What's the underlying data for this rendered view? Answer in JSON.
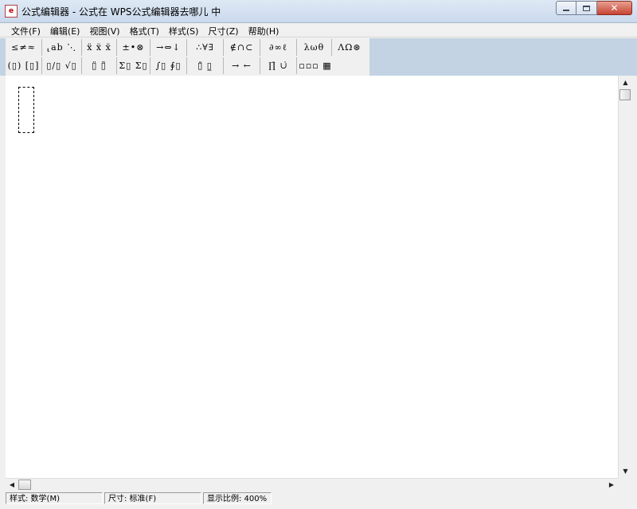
{
  "window": {
    "title": "公式编辑器 - 公式在 WPS公式编辑器去哪儿 中",
    "icon_label": "e",
    "controls": {
      "minimize_icon": "minimize-icon",
      "maximize_icon": "maximize-icon",
      "close_icon": "close-icon",
      "close_glyph": "✕"
    }
  },
  "menu": [
    {
      "label": "文件(F)"
    },
    {
      "label": "编辑(E)"
    },
    {
      "label": "视图(V)"
    },
    {
      "label": "格式(T)"
    },
    {
      "label": "样式(S)"
    },
    {
      "label": "尺寸(Z)"
    },
    {
      "label": "帮助(H)"
    }
  ],
  "toolbar": {
    "row1": [
      {
        "label": "≤≠≈",
        "name": "relations-palette"
      },
      {
        "label": "⸤ab ⋱",
        "name": "spaces-ellipses-palette"
      },
      {
        "label": "ẍ ẍ ẍ",
        "name": "embellishments-palette"
      },
      {
        "label": "±•⊗",
        "name": "operators-palette"
      },
      {
        "label": "→⇔↓",
        "name": "arrows-palette"
      },
      {
        "label": "∴∀∃",
        "name": "logic-palette"
      },
      {
        "label": "∉∩⊂",
        "name": "set-theory-palette"
      },
      {
        "label": "∂∞ℓ",
        "name": "misc-symbols-palette"
      },
      {
        "label": "λωθ",
        "name": "greek-lowercase-palette"
      },
      {
        "label": "ΛΩ⊛",
        "name": "greek-uppercase-palette"
      }
    ],
    "row2": [
      {
        "label": "(▯) [▯]",
        "name": "fences-templates"
      },
      {
        "label": "▯/▯ √▯",
        "name": "fractions-radicals-templates"
      },
      {
        "label": "▯̈ ▯̃",
        "name": "scripts-templates"
      },
      {
        "label": "Σ▯ Σ▯",
        "name": "summation-templates"
      },
      {
        "label": "∫▯ ∮▯",
        "name": "integral-templates"
      },
      {
        "label": "▯̄ ▯̲",
        "name": "bars-templates"
      },
      {
        "label": "→ ←",
        "name": "labeled-arrows-templates"
      },
      {
        "label": "∏̄ ∪̇",
        "name": "products-templates"
      },
      {
        "label": "▫▫▫ ▦",
        "name": "matrix-templates"
      }
    ]
  },
  "scrollbars": {
    "up": "▲",
    "down": "▼",
    "left": "◀",
    "right": "▶"
  },
  "status": {
    "style": "样式: 数学(M)",
    "size": "尺寸: 标准(F)",
    "zoom": "显示比例: 400%"
  }
}
